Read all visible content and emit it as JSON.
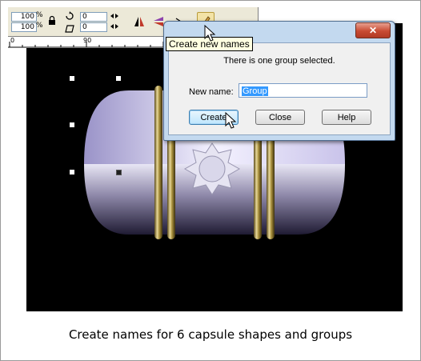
{
  "toolbar": {
    "width_value": "100",
    "height_value": "100",
    "percent_symbol": "%",
    "x_value": "0",
    "y_value": "0"
  },
  "ruler": {
    "label": "90",
    "origin": "0"
  },
  "tooltip": {
    "text": "Create new names"
  },
  "dialog": {
    "close_symbol": "✕",
    "message": "There is one group selected.",
    "name_label": "New name:",
    "name_value": "Group",
    "buttons": {
      "create": "Create",
      "close": "Close",
      "help": "Help"
    }
  },
  "caption": "Create names for 6 capsule shapes and groups",
  "colors": {
    "canvas": "#000000",
    "dialog_frame": "#c3d9ef",
    "close_red": "#c84a32",
    "tooltip_bg": "#ffffe1"
  }
}
